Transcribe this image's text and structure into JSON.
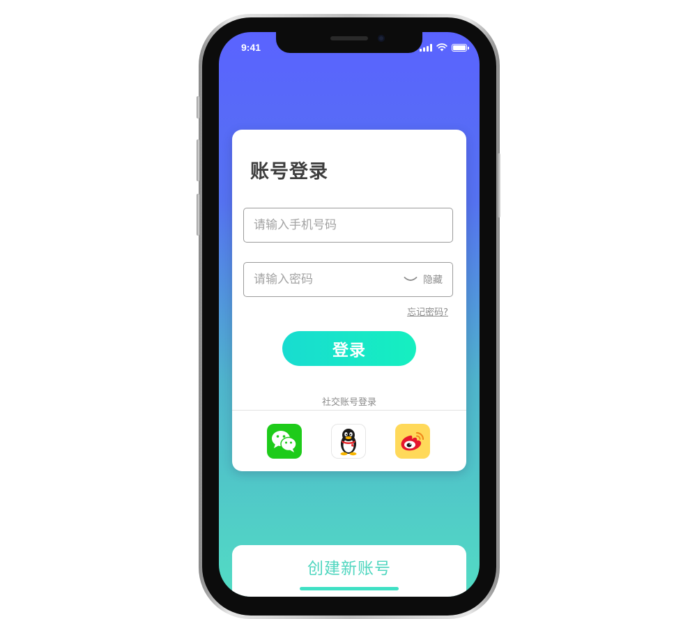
{
  "status_bar": {
    "time": "9:41"
  },
  "login": {
    "title": "账号登录",
    "phone_placeholder": "请输入手机号码",
    "password_placeholder": "请输入密码",
    "hide_label": "隐藏",
    "forgot_label": "忘记密码?",
    "login_label": "登录",
    "social_label": "社交账号登录"
  },
  "social": {
    "icons": [
      "wechat-icon",
      "qq-icon",
      "weibo-icon"
    ]
  },
  "create": {
    "label": "创建新账号"
  },
  "colors": {
    "gradient_top": "#5a63ff",
    "gradient_bottom": "#52dcc4",
    "login_button": "#16efc0",
    "create_text": "#4fd6bf",
    "wechat_green": "#1ecb1a",
    "weibo_yellow": "#ffd95a"
  }
}
